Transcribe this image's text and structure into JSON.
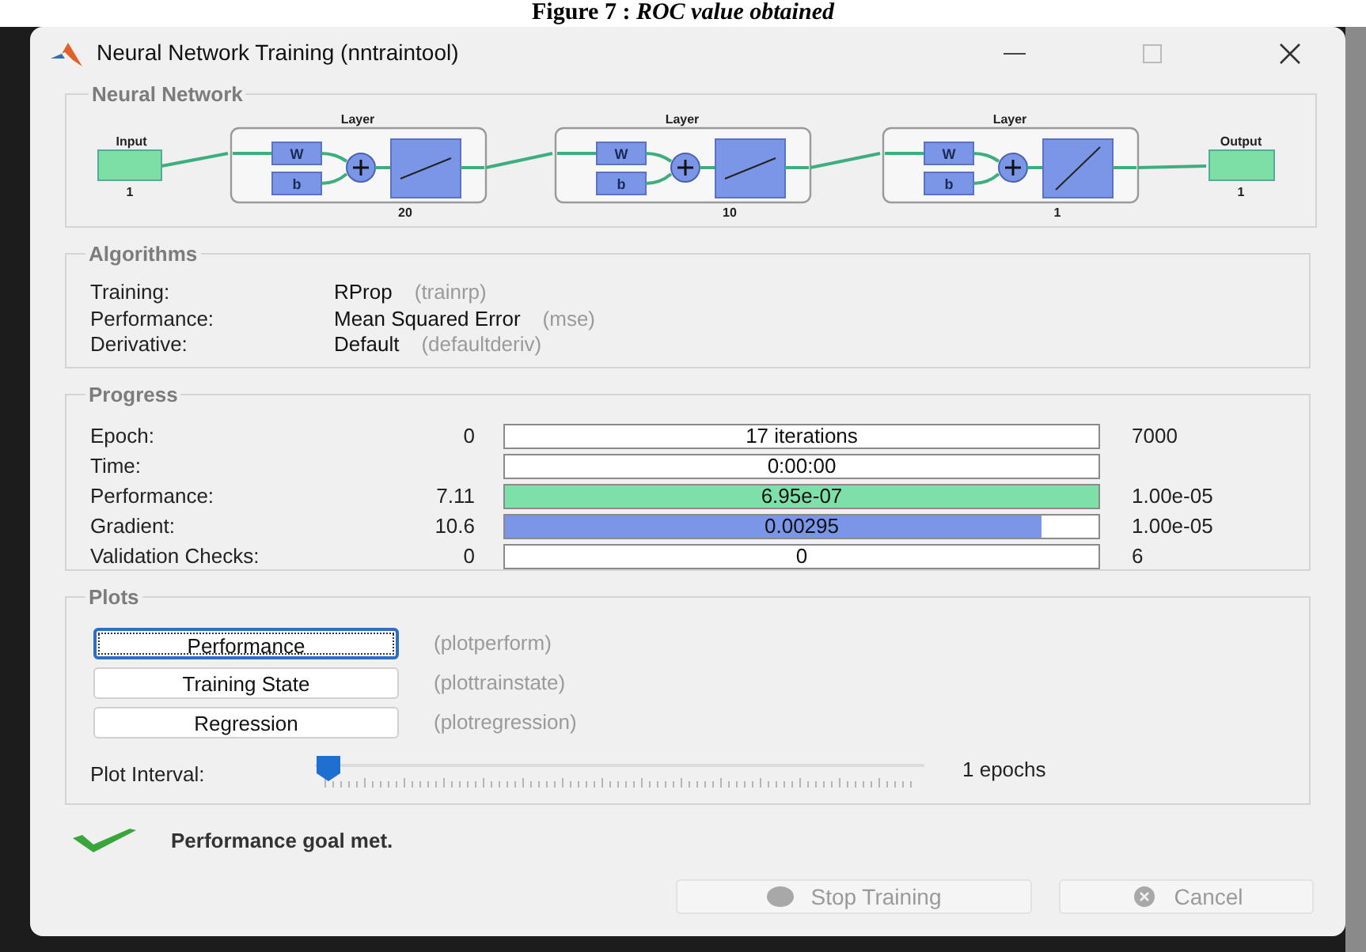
{
  "caption": "Figure 7 : *ROC value obtained*",
  "window": {
    "title": "Neural Network Training (nntraintool)"
  },
  "network": {
    "title": "Neural Network",
    "input": {
      "label": "Input",
      "size": "1"
    },
    "layers": [
      {
        "label": "Layer",
        "weight": "W",
        "bias": "b",
        "kind": "sigmoid",
        "size": "20"
      },
      {
        "label": "Layer",
        "weight": "W",
        "bias": "b",
        "kind": "sigmoid",
        "size": "10"
      },
      {
        "label": "Layer",
        "weight": "W",
        "bias": "b",
        "kind": "linear",
        "size": "1"
      }
    ],
    "output": {
      "label": "Output",
      "size": "1"
    }
  },
  "algorithms": {
    "title": "Algorithms",
    "rows": [
      {
        "label": "Training:",
        "value": "RProp",
        "function": "(trainrp)"
      },
      {
        "label": "Performance:",
        "value": "Mean Squared Error",
        "function": "(mse)"
      },
      {
        "label": "Derivative:",
        "value": "Default",
        "function": "(defaultderiv)"
      }
    ]
  },
  "progress": {
    "title": "Progress",
    "rows": [
      {
        "label": "Epoch:",
        "start": "0",
        "text": "17 iterations",
        "end": "7000"
      },
      {
        "label": "Time:",
        "text": "0:00:00"
      },
      {
        "label": "Performance:",
        "start": "7.11",
        "text": "6.95e-07",
        "level": 1,
        "color": "#7de0a8",
        "end": "1.00e-05"
      },
      {
        "label": "Gradient:",
        "start": "10.6",
        "text": "0.00295",
        "level": 0.905,
        "color": "#7b96e6",
        "end": "1.00e-05"
      },
      {
        "label": "Validation Checks:",
        "start": "0",
        "text": "0",
        "end": "6"
      }
    ]
  },
  "plots": {
    "title": "Plots",
    "buttons": [
      {
        "label": "Performance",
        "function": "(plotperform)",
        "focused": true
      },
      {
        "label": "Training State",
        "function": "(plottrainstate)",
        "focused": false
      },
      {
        "label": "Regression",
        "function": "(plotregression)",
        "focused": false
      }
    ],
    "interval": {
      "label": "Plot Interval:",
      "level": 0,
      "reading": "1 epochs"
    }
  },
  "status": {
    "text": "Performance goal met."
  },
  "buttons": [
    {
      "kind": "stop",
      "label": "Stop Training",
      "disabled": true
    },
    {
      "kind": "cancel",
      "label": "Cancel",
      "disabled": true
    }
  ]
}
